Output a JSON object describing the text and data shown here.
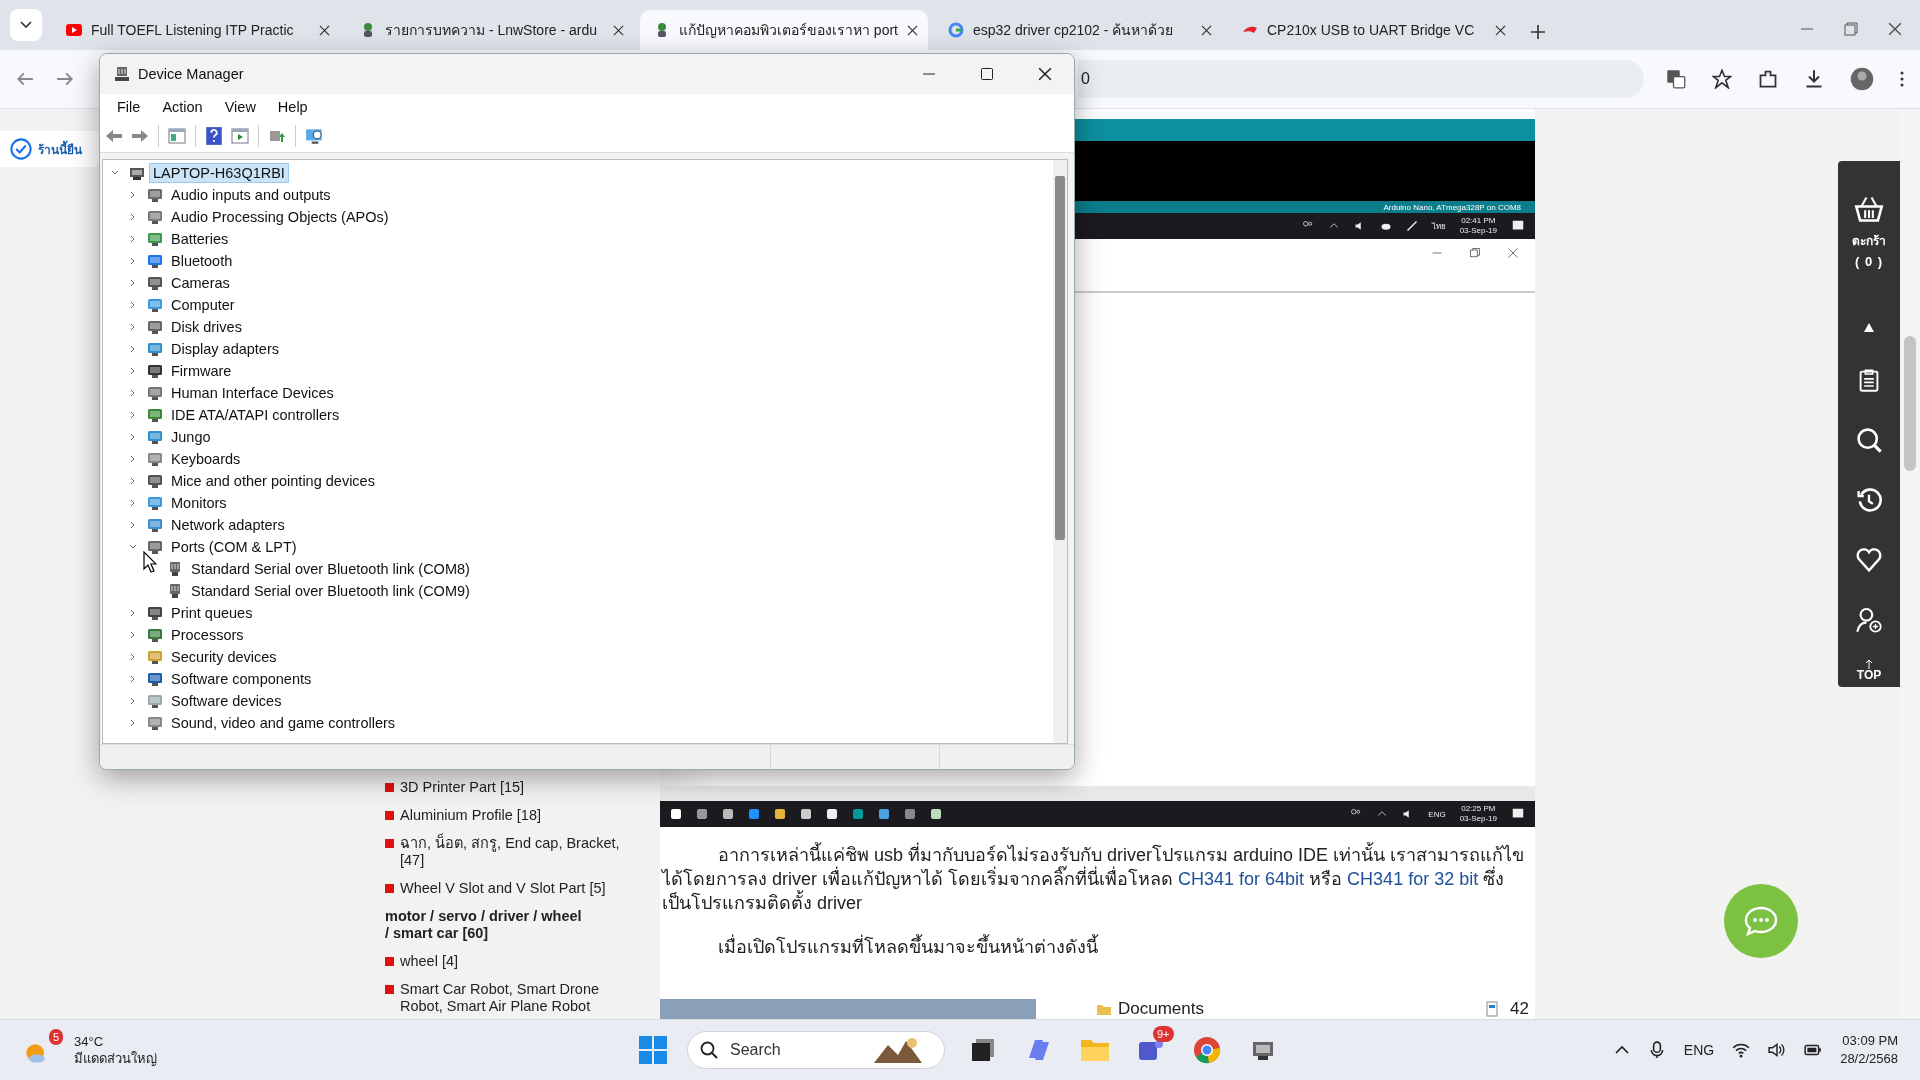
{
  "browser": {
    "tabs": [
      {
        "title": "Full TOEFL Listening ITP Practic",
        "kind": "video",
        "selected": false
      },
      {
        "title": "รายการบทความ - LnwStore - ardu",
        "kind": "shop",
        "selected": false
      },
      {
        "title": "แก้ปัญหาคอมพิวเตอร์ของเราหา port",
        "kind": "shop",
        "selected": true
      },
      {
        "title": "esp32 driver cp2102 - ค้นหาด้วย",
        "kind": "google",
        "selected": false
      },
      {
        "title": "CP210x USB to UART Bridge VC",
        "kind": "brand",
        "selected": false
      }
    ],
    "address_bar": {
      "value": "0"
    }
  },
  "page": {
    "notice": "ร้านนี้ยืน",
    "categories": [
      {
        "text": "3D Printer Part [15]",
        "kind": "item"
      },
      {
        "text": "Aluminium Profile [18]",
        "kind": "item"
      },
      {
        "text": "ฉาก, น็อต, สกรู, End cap, Bracket, [47]",
        "kind": "item"
      },
      {
        "text": "Wheel V Slot and V Slot Part [5]",
        "kind": "item"
      },
      {
        "text": "motor / servo / driver / wheel / smart car [60]",
        "kind": "heading"
      },
      {
        "text": "wheel [4]",
        "kind": "item"
      },
      {
        "text": "Smart Car Robot, Smart Drone Robot, Smart Air Plane Robot",
        "kind": "item"
      }
    ],
    "article": {
      "screenshot_top": {
        "status": "Arduino Nano, ATmega328P on COM8",
        "lang": "ไทย",
        "time": "02:41 PM",
        "date": "03-Sep-19"
      },
      "screenshot_bottom": {
        "lang": "ENG",
        "time": "02:25 PM",
        "date": "03-Sep-19"
      },
      "paragraphs": [
        [
          {
            "kind": "text",
            "text": "อาการเหล่านี้แค่ชิพ usb ที่มากับบอร์ดไม่รองรับกับ driverโปรแกรม arduino IDE เท่านั้น เราสามารถแก้ไขได้โดยการลง driver เพื่อแก้ปัญหาได้ โดยเริ่มจากคลิ๊กที่นี่เพื่อโหลด "
          },
          {
            "kind": "link",
            "text": "CH341 for 64bit"
          },
          {
            "kind": "text",
            "text": " หรือ "
          },
          {
            "kind": "link",
            "text": "CH341 for 32 bit"
          },
          {
            "kind": "text",
            "text": " ซึ่งเป็นโปรแกรมติดตั้ง driver"
          }
        ],
        [
          {
            "kind": "text",
            "text": "เมื่อเปิดโปรแกรมที่โหลดขึ้นมาจะขึ้นหน้าต่างดังนี้"
          }
        ]
      ],
      "image_bottom": {
        "folder": "Documents",
        "number": "42"
      }
    },
    "sidebar": {
      "cart_label": "ตะกร้า",
      "cart_count": "( 0 )",
      "top_label": "TOP"
    }
  },
  "device_manager": {
    "title": "Device Manager",
    "menu": [
      "File",
      "Action",
      "View",
      "Help"
    ],
    "tree": {
      "label": "LAPTOP-H63Q1RBI",
      "selected": true,
      "expanded": true,
      "children": [
        {
          "label": "Audio inputs and outputs",
          "selected": false,
          "expanded": false
        },
        {
          "label": "Audio Processing Objects (APOs)",
          "selected": false,
          "expanded": false
        },
        {
          "label": "Batteries",
          "selected": false,
          "expanded": false
        },
        {
          "label": "Bluetooth",
          "selected": false,
          "expanded": false
        },
        {
          "label": "Cameras",
          "selected": false,
          "expanded": false
        },
        {
          "label": "Computer",
          "selected": false,
          "expanded": false
        },
        {
          "label": "Disk drives",
          "selected": false,
          "expanded": false
        },
        {
          "label": "Display adapters",
          "selected": false,
          "expanded": false
        },
        {
          "label": "Firmware",
          "selected": false,
          "expanded": false
        },
        {
          "label": "Human Interface Devices",
          "selected": false,
          "expanded": false
        },
        {
          "label": "IDE ATA/ATAPI controllers",
          "selected": false,
          "expanded": false
        },
        {
          "label": "Jungo",
          "selected": false,
          "expanded": false
        },
        {
          "label": "Keyboards",
          "selected": false,
          "expanded": false
        },
        {
          "label": "Mice and other pointing devices",
          "selected": false,
          "expanded": false
        },
        {
          "label": "Monitors",
          "selected": false,
          "expanded": false
        },
        {
          "label": "Network adapters",
          "selected": false,
          "expanded": false
        },
        {
          "label": "Ports (COM & LPT)",
          "selected": false,
          "expanded": true,
          "children": [
            {
              "label": "Standard Serial over Bluetooth link (COM8)",
              "selected": false
            },
            {
              "label": "Standard Serial over Bluetooth link (COM9)",
              "selected": false
            }
          ]
        },
        {
          "label": "Print queues",
          "selected": false,
          "expanded": false
        },
        {
          "label": "Processors",
          "selected": false,
          "expanded": false
        },
        {
          "label": "Security devices",
          "selected": false,
          "expanded": false
        },
        {
          "label": "Software components",
          "selected": false,
          "expanded": false
        },
        {
          "label": "Software devices",
          "selected": false,
          "expanded": false
        },
        {
          "label": "Sound, video and game controllers",
          "selected": false,
          "expanded": false
        }
      ]
    }
  },
  "taskbar": {
    "weather": {
      "badge": "5",
      "temp": "34°C",
      "text": "มีแดดส่วนใหญ่"
    },
    "search": {
      "placeholder": "Search"
    },
    "teams_badge": "9+",
    "lang": "ENG",
    "time": "03:09 PM",
    "date": "28/2/2568"
  }
}
